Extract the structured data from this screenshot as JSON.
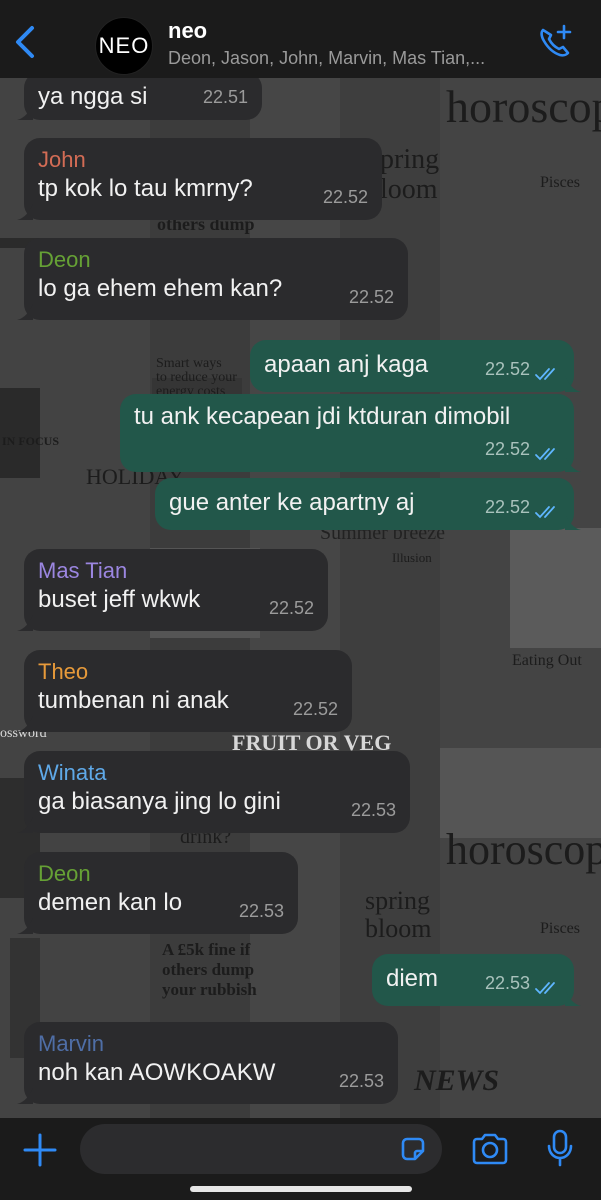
{
  "header": {
    "back_icon": "chevron-left-icon",
    "avatar_text": "NEO",
    "title": "neo",
    "subtitle": "Deon, Jason, John, Marvin, Mas Tian,...",
    "call_icon": "phone-plus-icon"
  },
  "messages": [
    {
      "dir": "in",
      "sender": "",
      "text": "ya ngga si",
      "time": "22.51"
    },
    {
      "dir": "in",
      "sender": "John",
      "sender_color": "#d36c55",
      "text": "tp kok lo tau kmrny?",
      "time": "22.52"
    },
    {
      "dir": "in",
      "sender": "Deon",
      "sender_color": "#66a135",
      "text": "lo ga ehem ehem kan?",
      "time": "22.52"
    },
    {
      "dir": "out",
      "text": "apaan anj kaga",
      "time": "22.52"
    },
    {
      "dir": "out",
      "text": "tu ank kecapean jdi ktduran dimobil",
      "time": "22.52"
    },
    {
      "dir": "out",
      "text": "gue anter ke apartny aj",
      "time": "22.52"
    },
    {
      "dir": "in",
      "sender": "Mas Tian",
      "sender_color": "#9b86e0",
      "text": "buset jeff wkwk",
      "time": "22.52"
    },
    {
      "dir": "in",
      "sender": "Theo",
      "sender_color": "#e79a3a",
      "text": "tumbenan ni anak",
      "time": "22.52"
    },
    {
      "dir": "in",
      "sender": "Winata",
      "sender_color": "#5fa9e8",
      "text": "ga biasanya jing lo gini",
      "time": "22.53"
    },
    {
      "dir": "in",
      "sender": "Deon",
      "sender_color": "#66a135",
      "text": "demen kan lo",
      "time": "22.53"
    },
    {
      "dir": "out",
      "text": "diem",
      "time": "22.53"
    },
    {
      "dir": "in",
      "sender": "Marvin",
      "sender_color": "#4f6ea6",
      "text": "noh kan AOWKOAKW",
      "time": "22.53"
    }
  ],
  "wallpaper_text": {
    "horoscope_1": "horoscop",
    "spring": "pring",
    "bloom": "loom",
    "others_dump": "others dump",
    "holiday": "HOLIDAY",
    "summer": "Summer breeze",
    "fruit": "FRUIT OR VEG",
    "horoscope_2": "horoscop",
    "spring_2": "spring",
    "bloom_2": "bloom",
    "fine": "A £5k fine if",
    "others_2": "others dump",
    "rubbish": "your rubbish",
    "news": "NEWS",
    "smart_ways": "Smart ways",
    "reduce": "to reduce your",
    "energy": "energy costs",
    "in_focus": "IN FOCUS",
    "eating": "Eating Out",
    "pisces": "Pisces",
    "pisces_2": "Pisces",
    "password": "ossword",
    "drink": "drink?",
    "illusion": "Illusion"
  },
  "input": {
    "placeholder": "",
    "plus_icon": "plus-icon",
    "sticker_icon": "sticker-icon",
    "camera_icon": "camera-icon",
    "mic_icon": "microphone-icon"
  },
  "colors": {
    "incoming_bubble": "#2b2b2d",
    "outgoing_bubble": "#22574a",
    "accent": "#2f8af5",
    "read_ticks": "#5fb6ff"
  }
}
